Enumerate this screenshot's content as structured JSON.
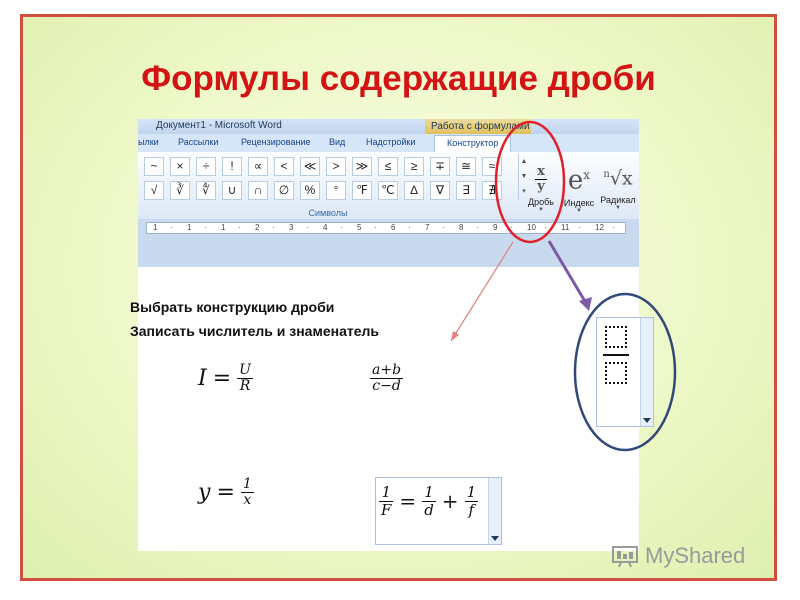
{
  "slide": {
    "title": "Формулы содержащие дроби",
    "border_color": "#d0503f",
    "title_color": "#d41414"
  },
  "window": {
    "title": "Документ1 - Microsoft Word",
    "context_tab": "Работа с формулами"
  },
  "ribbon": {
    "tabs": [
      {
        "label": "ылки"
      },
      {
        "label": "Рассылки"
      },
      {
        "label": "Рецензирование"
      },
      {
        "label": "Вид"
      },
      {
        "label": "Надстройки"
      },
      {
        "label": "Конструктор",
        "active": true
      }
    ],
    "symbols_row1": [
      "~",
      "×",
      "÷",
      "!",
      "∝",
      "<",
      "≪",
      ">",
      "≫",
      "≤",
      "≥",
      "∓",
      "≅",
      "≈"
    ],
    "symbols_row2": [
      "√",
      "∛",
      "∜",
      "∪",
      "∩",
      "∅",
      "%",
      "°",
      "℉",
      "℃",
      "∆",
      "∇",
      "∃",
      "∄"
    ],
    "group_label": "Символы",
    "buttons": [
      {
        "label": "Дробь",
        "icon": "fraction-x-over-y-icon",
        "glyph_top": "x",
        "glyph_bottom": "y"
      },
      {
        "label": "Индекс",
        "icon": "e-superscript-x-icon",
        "glyph": "e",
        "glyph_sup": "x"
      },
      {
        "label": "Радикал",
        "icon": "nth-root-x-icon",
        "glyph_sup": "n",
        "glyph": "√x"
      }
    ]
  },
  "ruler": {
    "marks": [
      "1",
      "·",
      "1",
      "·",
      "1",
      "·",
      "2",
      "·",
      "3",
      "·",
      "4",
      "·",
      "5",
      "·",
      "6",
      "·",
      "7",
      "·",
      "8",
      "·",
      "9",
      "·",
      "10",
      "·",
      "11",
      "·",
      "12",
      "·"
    ]
  },
  "instructions": [
    "Выбрать конструкцию дроби",
    "Записать числитель и знаменатель"
  ],
  "formulas": [
    {
      "lhs": "I",
      "op": "=",
      "num": "U",
      "den": "R"
    },
    {
      "num": "a+b",
      "den": "c−d"
    },
    {
      "lhs": "y",
      "op": "=",
      "num": "1",
      "den": "x"
    },
    {
      "terms": [
        {
          "num": "1",
          "den": "F"
        },
        {
          "op": "="
        },
        {
          "num": "1",
          "den": "d"
        },
        {
          "op": "+"
        },
        {
          "num": "1",
          "den": "f"
        }
      ]
    }
  ],
  "watermark": "MyShared",
  "annotation_colors": {
    "red_ellipse": "#e0202a",
    "blue_ellipse": "#2f4a7a",
    "purple_arrow": "#7d5aa6"
  }
}
